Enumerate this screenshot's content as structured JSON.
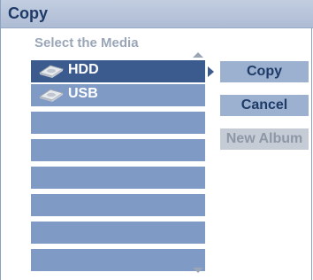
{
  "dialog": {
    "title": "Copy",
    "subtitle": "Select the Media"
  },
  "media_list": {
    "items": [
      {
        "label": "HDD",
        "icon": "hard-drive-icon",
        "selected": true
      },
      {
        "label": "USB",
        "icon": "usb-drive-icon",
        "selected": false
      },
      {
        "label": "",
        "selected": false
      },
      {
        "label": "",
        "selected": false
      },
      {
        "label": "",
        "selected": false
      },
      {
        "label": "",
        "selected": false
      },
      {
        "label": "",
        "selected": false
      },
      {
        "label": "",
        "selected": false
      },
      {
        "label": "",
        "selected": false
      }
    ]
  },
  "buttons": {
    "copy": "Copy",
    "cancel": "Cancel",
    "new_album": "New Album"
  },
  "colors": {
    "selected_row": "#3b5b8f",
    "row": "#7f9ac4",
    "button": "#9cb1d0",
    "button_disabled": "#c5ccd6"
  }
}
